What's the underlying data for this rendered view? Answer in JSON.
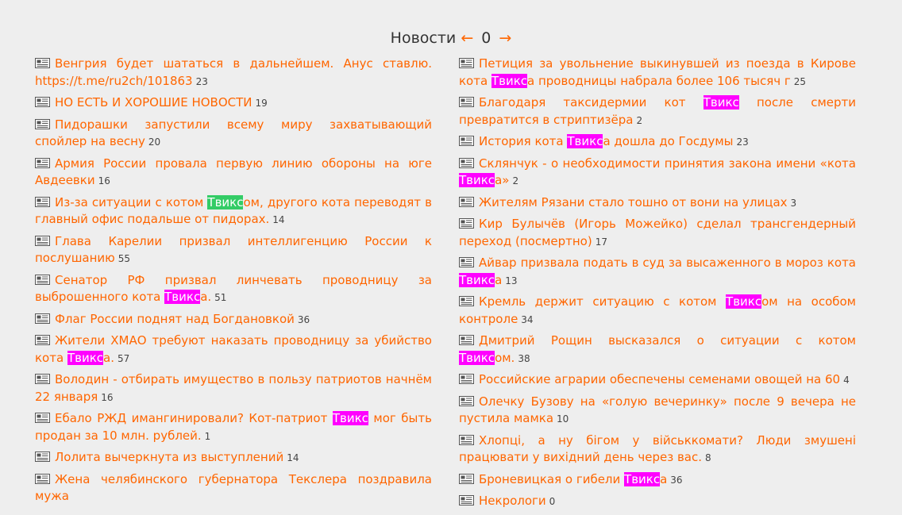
{
  "header": {
    "title": "Новости",
    "prev": "←",
    "page": "0",
    "next": "→"
  },
  "colors": {
    "link": "#ff6600",
    "highlight_magenta": "#ff00ff",
    "highlight_green": "#33cc66",
    "background": "#eeeeee"
  },
  "icon": "newspaper-icon",
  "left": [
    {
      "parts": [
        {
          "t": "Венгрия будет шататься в дальнейшем. Анус ставлю. https://t.me/ru2ch/101863"
        }
      ],
      "count": "23"
    },
    {
      "parts": [
        {
          "t": "НО ЕСТЬ И ХОРОШИЕ НОВОСТИ"
        }
      ],
      "count": "19"
    },
    {
      "parts": [
        {
          "t": "Пидорашки запустили всему миру захватывающий спойлер на весну"
        }
      ],
      "count": "20"
    },
    {
      "parts": [
        {
          "t": "Армия России провала первую линию обороны на юге Авдеевки"
        }
      ],
      "count": "16"
    },
    {
      "parts": [
        {
          "t": "Из-за ситуации с котом "
        },
        {
          "t": "Твикс",
          "hl": "g"
        },
        {
          "t": "ом, другого кота переводят в главный офис подальше от пидорах."
        }
      ],
      "count": "14"
    },
    {
      "parts": [
        {
          "t": "Глава Карелии призвал интеллигенцию России к послушанию"
        }
      ],
      "count": "55"
    },
    {
      "parts": [
        {
          "t": "Сенатор РФ призвал линчевать проводницу за выброшенного кота "
        },
        {
          "t": "Твикс",
          "hl": "m"
        },
        {
          "t": "а."
        }
      ],
      "count": "51"
    },
    {
      "parts": [
        {
          "t": "Флаг России поднят над Богдановкой"
        }
      ],
      "count": "36"
    },
    {
      "parts": [
        {
          "t": "Жители ХМАО требуют наказать проводницу за убийство кота "
        },
        {
          "t": "Твикс",
          "hl": "m"
        },
        {
          "t": "а."
        }
      ],
      "count": "57"
    },
    {
      "parts": [
        {
          "t": "Володин - отбирать имущество в пользу патриотов начнём 22 января"
        }
      ],
      "count": "16"
    },
    {
      "parts": [
        {
          "t": "Ебало РЖД имангинировали? Кот-патриот "
        },
        {
          "t": "Твикс",
          "hl": "m"
        },
        {
          "t": " мог быть продан за 10 млн. рублей."
        }
      ],
      "count": "1"
    },
    {
      "parts": [
        {
          "t": "Лолита вычеркнута из выступлений"
        }
      ],
      "count": "14"
    },
    {
      "parts": [
        {
          "t": "Жена челябинского губернатора Текслера поздравила мужа"
        }
      ],
      "count": ""
    }
  ],
  "right": [
    {
      "parts": [
        {
          "t": "Петиция за увольнение выкинувшей из поезда в Кирове кота "
        },
        {
          "t": "Твикс",
          "hl": "m"
        },
        {
          "t": "а проводницы набрала более 106 тысяч г"
        }
      ],
      "count": "25"
    },
    {
      "parts": [
        {
          "t": "Благодаря таксидермии кот "
        },
        {
          "t": "Твикс",
          "hl": "m"
        },
        {
          "t": " после смерти превратится в стриптизёра"
        }
      ],
      "count": "2"
    },
    {
      "parts": [
        {
          "t": "История кота "
        },
        {
          "t": "Твикс",
          "hl": "m"
        },
        {
          "t": "а дошла до Госдумы"
        }
      ],
      "count": "23"
    },
    {
      "parts": [
        {
          "t": "Склянчук - о необходимости принятия закона имени «кота "
        },
        {
          "t": "Твикс",
          "hl": "m"
        },
        {
          "t": "а»"
        }
      ],
      "count": "2"
    },
    {
      "parts": [
        {
          "t": "Жителям Рязани стало тошно от вони на улицах"
        }
      ],
      "count": "3"
    },
    {
      "parts": [
        {
          "t": "Кир Булычёв (Игорь Можейко) сделал трансгендерный переход (посмертно)"
        }
      ],
      "count": "17"
    },
    {
      "parts": [
        {
          "t": "Айвар призвала подать в суд за высаженного в мороз кота "
        },
        {
          "t": "Твикс",
          "hl": "m"
        },
        {
          "t": "а"
        }
      ],
      "count": "13"
    },
    {
      "parts": [
        {
          "t": "Кремль держит ситуацию с котом "
        },
        {
          "t": "Твикс",
          "hl": "m"
        },
        {
          "t": "ом на особом контроле"
        }
      ],
      "count": "34"
    },
    {
      "parts": [
        {
          "t": "Дмитрий Рощин высказался о ситуации с котом "
        },
        {
          "t": "Твикс",
          "hl": "m"
        },
        {
          "t": "ом."
        }
      ],
      "count": "38"
    },
    {
      "parts": [
        {
          "t": "Российские аграрии обеспечены семенами овощей на 60"
        }
      ],
      "count": "4"
    },
    {
      "parts": [
        {
          "t": "Олечку Бузову на «голую вечеринку» после 9 вечера не пустила мамка"
        }
      ],
      "count": "10"
    },
    {
      "parts": [
        {
          "t": "Хлопці, а ну бігом у військкомати? Люди змушені працювати у вихідний день через вас."
        }
      ],
      "count": "8"
    },
    {
      "parts": [
        {
          "t": "Броневицкая о гибели "
        },
        {
          "t": "Твикс",
          "hl": "m"
        },
        {
          "t": "а"
        }
      ],
      "count": "36"
    },
    {
      "parts": [
        {
          "t": "Некрологи"
        }
      ],
      "count": "0"
    }
  ]
}
